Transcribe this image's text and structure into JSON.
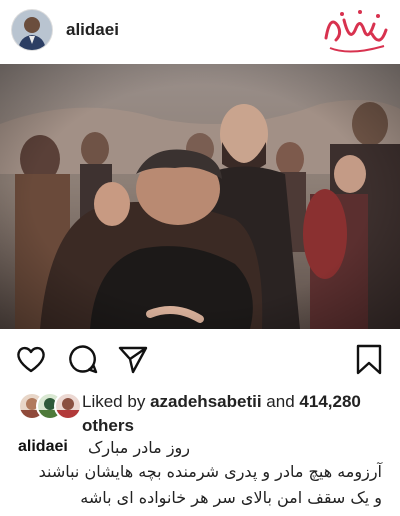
{
  "post": {
    "username": "alidaei"
  },
  "actions": {
    "like_icon": "heart-icon",
    "comment_icon": "comment-icon",
    "share_icon": "paper-plane-icon",
    "save_icon": "bookmark-icon"
  },
  "likes": {
    "prefix": "Liked by",
    "liker": "azadehsabetii",
    "conjunction": "and",
    "count": "414,280",
    "suffix": "others"
  },
  "caption": {
    "username": "alidaei",
    "line1": "روز مادر مبارک",
    "line2": "آرزومه هیچ مادر و پدری شرمنده بچه هایشان نباشند",
    "line3": "و یک سقف امن بالای سر هر خانواده ای باشه"
  },
  "colors": {
    "text": "#222222",
    "background": "#ffffff",
    "watermark": "#e23b62"
  }
}
